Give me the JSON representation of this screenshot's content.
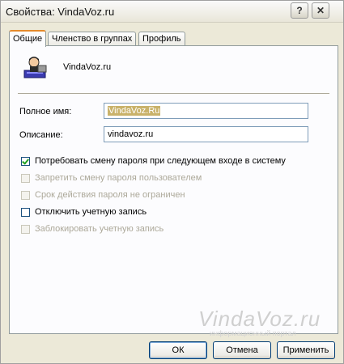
{
  "window": {
    "title": "Свойства: VindaVoz.ru",
    "help_label": "?",
    "close_label": "✕"
  },
  "tabs": [
    {
      "label": "Общие",
      "active": true
    },
    {
      "label": "Членство в группах",
      "active": false
    },
    {
      "label": "Профиль",
      "active": false
    }
  ],
  "user": {
    "name": "VindaVoz.ru",
    "icon": "user-icon"
  },
  "fields": {
    "full_name": {
      "label": "Полное имя:",
      "value": "VindaVoz.Ru"
    },
    "description": {
      "label": "Описание:",
      "value": "vindavoz.ru"
    }
  },
  "checkboxes": [
    {
      "label": "Потребовать смену пароля при следующем входе в систему",
      "checked": true,
      "enabled": true
    },
    {
      "label": "Запретить смену пароля пользователем",
      "checked": false,
      "enabled": false
    },
    {
      "label": "Срок действия пароля не ограничен",
      "checked": false,
      "enabled": false
    },
    {
      "label": "Отключить учетную запись",
      "checked": false,
      "enabled": true
    },
    {
      "label": "Заблокировать учетную запись",
      "checked": false,
      "enabled": false
    }
  ],
  "watermark": {
    "text": "VindaVoz.ru",
    "sub": "информационный портал"
  },
  "buttons": {
    "ok": "ОК",
    "cancel": "Отмена",
    "apply": "Применить"
  }
}
